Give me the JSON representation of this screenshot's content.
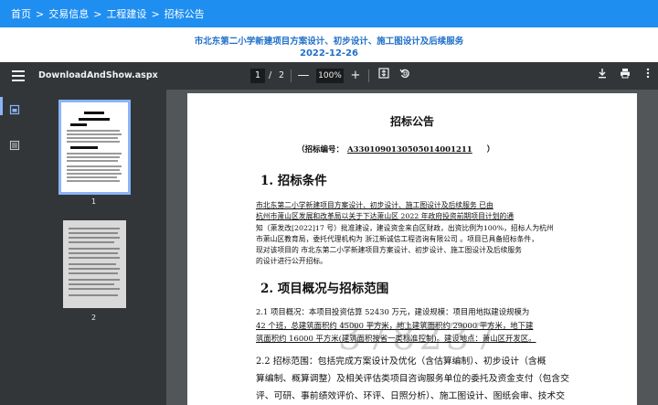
{
  "breadcrumb": {
    "items": [
      "首页",
      "交易信息",
      "工程建设",
      "招标公告"
    ],
    "separator": ">"
  },
  "header": {
    "title": "市北东第二小学新建项目方案设计、初步设计、施工图设计及后续服务",
    "date": "2022-12-26"
  },
  "viewer": {
    "filename": "DownloadAndShow.aspx",
    "page_current": "1",
    "page_separator": "/",
    "page_total": "2",
    "zoom": "100%",
    "zoom_out": "—",
    "zoom_in": "+",
    "thumbs": [
      {
        "label": "1"
      },
      {
        "label": "2"
      }
    ]
  },
  "document": {
    "title": "招标公告",
    "number_prefix": "（招标编号：",
    "number": "A3301090130505014001211",
    "number_suffix": "）",
    "section1": "1.   招标条件",
    "s1_lines": [
      "    市北东第二小学新建项目方案设计、初步设计、施工图设计及后续服务    已由",
      "杭州市萧山区发展和改革局以关于下达萧山区 2022 年政府投资前期项目计划的通",
      "知（萧发改[2022]17 号）批准建设，建设资金来自区财政，出资比例为100%，招标人为杭州",
      "市萧山区教育局，委托代理机构为      浙江新诚信工程咨询有限公司   。项目已具备招标条件，",
      "现对该项目的       市北东第二小学新建项目方案设计、初步设计、施工图设计及后续服务",
      "的设计进行公开招标。"
    ],
    "section2": "2.   项目概况与招标范围",
    "s2_lines": [
      "    2.1  项目概况：本项目投资估算 52430 万元，建设规模：项目用地拟建设规模为",
      "42 个班，总建筑面积约 45000 平方米，地上建筑面积约 29000 平方米，地下建",
      "筑面积约 16000 平方米(建筑面积按省一类标准控制)。建设地点：萧山区开发区。"
    ],
    "s3_lines": [
      "    2.2  招标范围：包括完成方案设计及优化（含估算编制）、初步设计（含概",
      "算编制、概算调整）及相关评估类项目咨询服务单位的委托及资金支付（包含交",
      "评、可研、事前绩效评价、环评、日照分析）、施工图设计、图纸会审、技术交"
    ],
    "watermark": "378237"
  },
  "colors": {
    "topbar": "#1f8ef1",
    "header_text": "#1f6fc9",
    "viewer_bg": "#525659",
    "toolbar_bg": "#323639",
    "thumb_outline": "#8ab4f8"
  },
  "icons": [
    "menu-icon",
    "fit-page-icon",
    "rotate-icon",
    "download-icon",
    "print-icon",
    "more-vert-icon",
    "thumbnails-icon",
    "outline-icon"
  ]
}
